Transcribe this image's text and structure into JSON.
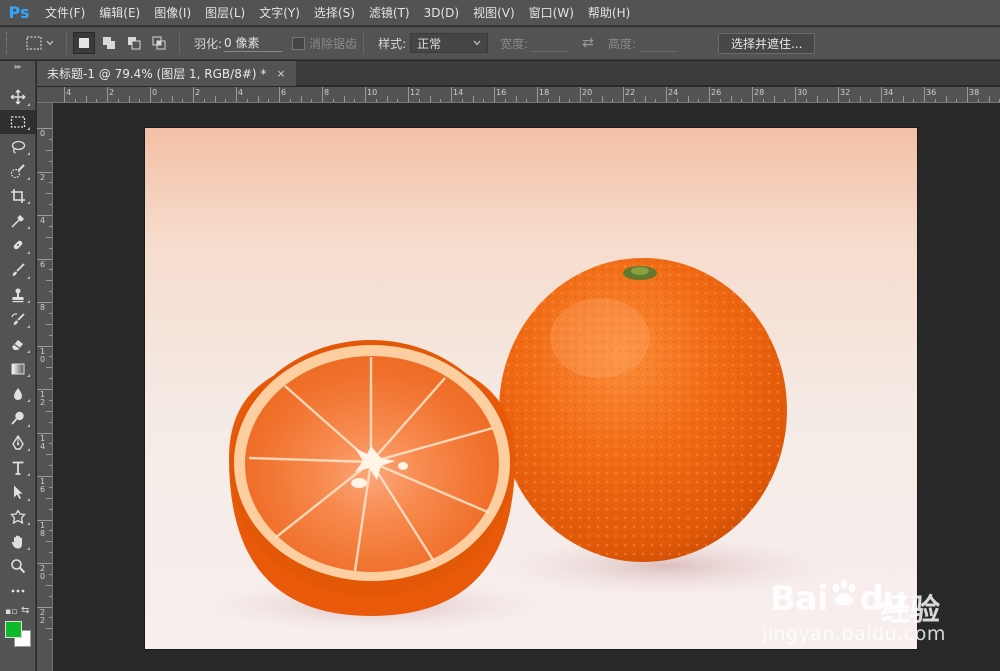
{
  "app": {
    "logo": "Ps"
  },
  "menu": [
    "文件(F)",
    "编辑(E)",
    "图像(I)",
    "图层(L)",
    "文字(Y)",
    "选择(S)",
    "滤镜(T)",
    "3D(D)",
    "视图(V)",
    "窗口(W)",
    "帮助(H)"
  ],
  "options": {
    "feather_label": "羽化:",
    "feather_value": "0 像素",
    "antialias_label": "消除锯齿",
    "style_label": "样式:",
    "style_value": "正常",
    "width_label": "宽度:",
    "height_label": "高度:",
    "select_mask_label": "选择并遮住..."
  },
  "document_tab": {
    "title": "未标题-1 @ 79.4% (图层 1, RGB/8#) *",
    "close": "×"
  },
  "ruler_top": [
    "4",
    "2",
    "0",
    "2",
    "4",
    "6",
    "8",
    "10",
    "12",
    "14",
    "16",
    "18",
    "20",
    "22",
    "24",
    "26",
    "28",
    "30",
    "32",
    "34",
    "36",
    "38"
  ],
  "ruler_left": [
    "0",
    "2",
    "4",
    "6",
    "8",
    "10",
    "12",
    "14",
    "16",
    "18",
    "20",
    "22"
  ],
  "colors": {
    "foreground": "#0fba2a",
    "background": "#ffffff"
  },
  "watermark": {
    "brand": "Bai",
    "brand2": "du",
    "cn": "经验",
    "sub": "jingyan.baidu.com"
  },
  "tools": [
    "move-tool-icon",
    "marquee-tool-icon",
    "lasso-tool-icon",
    "quick-select-tool-icon",
    "crop-tool-icon",
    "eyedropper-tool-icon",
    "healing-brush-icon",
    "brush-tool-icon",
    "clone-stamp-icon",
    "history-brush-icon",
    "eraser-tool-icon",
    "gradient-tool-icon",
    "blur-tool-icon",
    "dodge-tool-icon",
    "pen-tool-icon",
    "type-tool-icon",
    "path-select-icon",
    "shape-tool-icon",
    "hand-tool-icon",
    "zoom-tool-icon",
    "more-tools-icon"
  ]
}
